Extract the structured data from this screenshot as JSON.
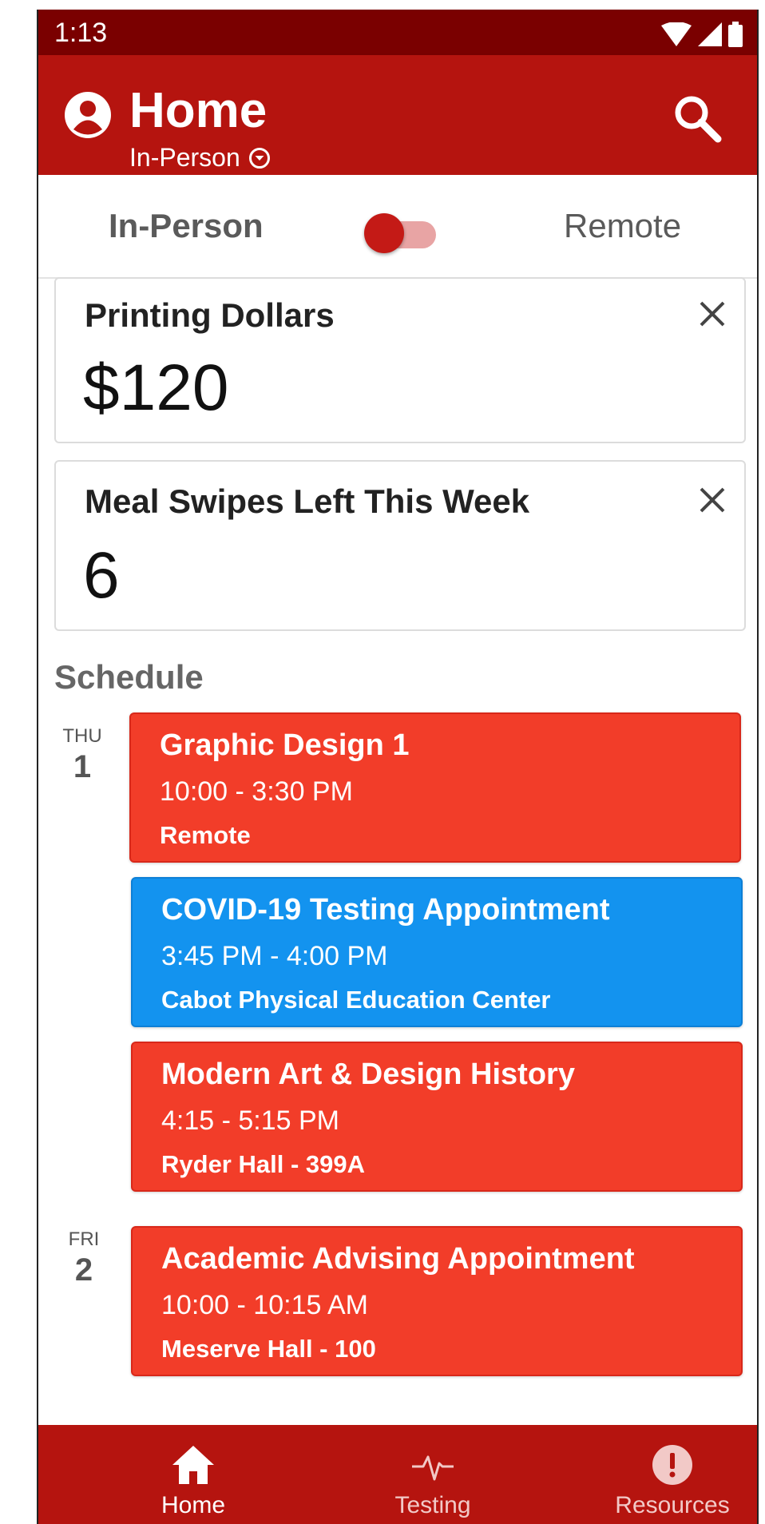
{
  "status_bar": {
    "time": "1:13"
  },
  "app_bar": {
    "title": "Home",
    "subtitle": "In-Person"
  },
  "mode_toggle": {
    "left_label": "In-Person",
    "right_label": "Remote",
    "selected": "In-Person"
  },
  "cards": [
    {
      "title": "Printing Dollars",
      "value": "$120"
    },
    {
      "title": "Meal Swipes Left This Week",
      "value": "6"
    }
  ],
  "schedule": {
    "heading": "Schedule",
    "days": [
      {
        "day_name": "THU",
        "day_num": "1",
        "events": [
          {
            "title": "Graphic Design 1",
            "time": "10:00 - 3:30 PM",
            "location": "Remote",
            "color": "#f23d29"
          },
          {
            "title": "COVID-19 Testing Appointment",
            "time": "3:45 PM - 4:00 PM",
            "location": "Cabot Physical Education Center",
            "color": "#1393ef"
          },
          {
            "title": "Modern Art & Design History",
            "time": "4:15 - 5:15 PM",
            "location": "Ryder Hall - 399A",
            "color": "#f23d29"
          }
        ]
      },
      {
        "day_name": "FRI",
        "day_num": "2",
        "events": [
          {
            "title": "Academic Advising Appointment",
            "time": "10:00 - 10:15 AM",
            "location": "Meserve Hall - 100",
            "color": "#f23d29"
          }
        ]
      }
    ]
  },
  "bottom_nav": {
    "items": [
      {
        "label": "Home",
        "icon": "home-icon",
        "active": true
      },
      {
        "label": "Testing",
        "icon": "pulse-icon",
        "active": false
      },
      {
        "label": "Resources",
        "icon": "alert-circle-icon",
        "active": false
      }
    ]
  },
  "colors": {
    "brand_red": "#b5140f",
    "status_bar": "#7a0000",
    "event_red": "#f23d29",
    "event_blue": "#1393ef"
  }
}
